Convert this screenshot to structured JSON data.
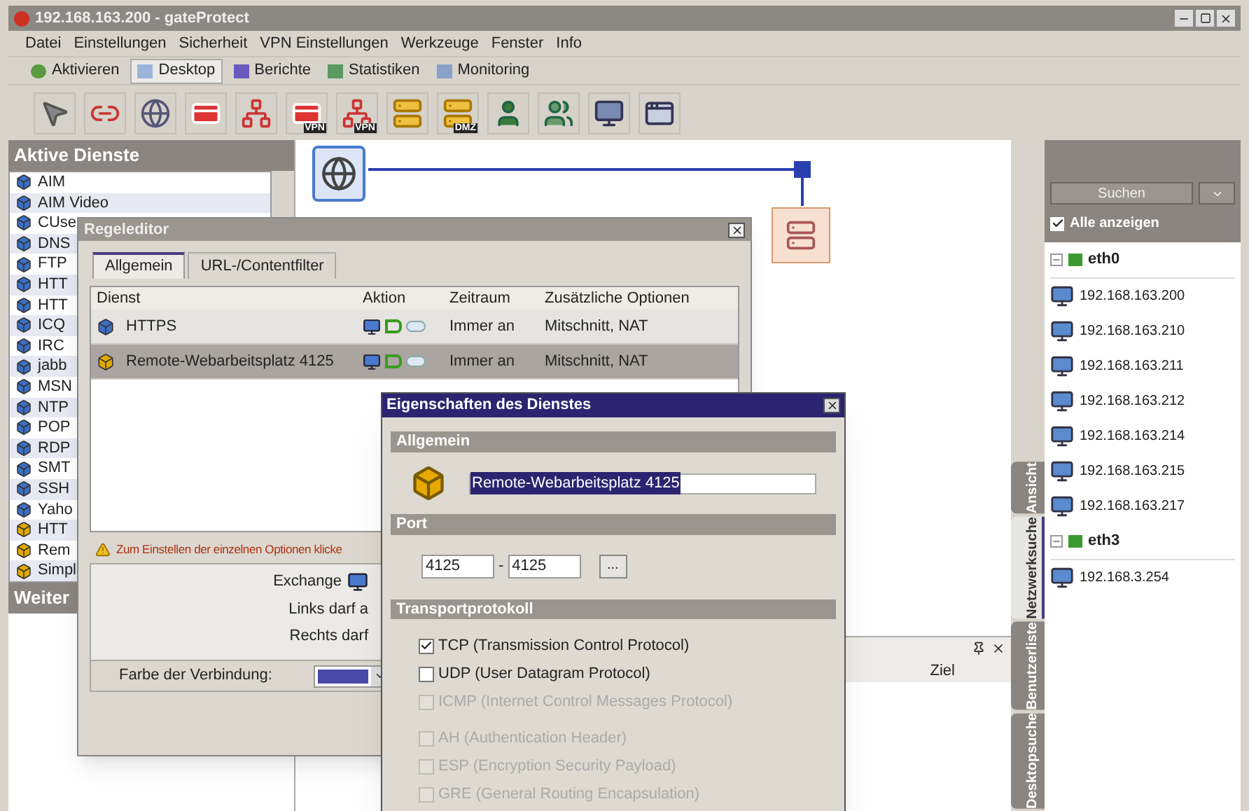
{
  "window": {
    "title": "192.168.163.200 - gateProtect"
  },
  "menu": [
    "Datei",
    "Einstellungen",
    "Sicherheit",
    "VPN Einstellungen",
    "Werkzeuge",
    "Fenster",
    "Info"
  ],
  "nav_tabs": [
    {
      "label": "Aktivieren",
      "selected": false
    },
    {
      "label": "Desktop",
      "selected": true
    },
    {
      "label": "Berichte",
      "selected": false
    },
    {
      "label": "Statistiken",
      "selected": false
    },
    {
      "label": "Monitoring",
      "selected": false
    }
  ],
  "toolbar": [
    {
      "kind": "pointer"
    },
    {
      "kind": "connect"
    },
    {
      "kind": "globe"
    },
    {
      "kind": "card"
    },
    {
      "kind": "link"
    },
    {
      "kind": "card",
      "badge": "VPN"
    },
    {
      "kind": "link",
      "badge": "VPN"
    },
    {
      "kind": "server"
    },
    {
      "kind": "server",
      "badge": "DMZ"
    },
    {
      "kind": "user"
    },
    {
      "kind": "users"
    },
    {
      "kind": "screen"
    },
    {
      "kind": "window"
    }
  ],
  "services_panel": {
    "title": "Aktive Dienste",
    "items": [
      {
        "name": "AIM",
        "kind": "blue"
      },
      {
        "name": "AIM Video",
        "kind": "blue"
      },
      {
        "name": "CUse",
        "kind": "blue"
      },
      {
        "name": "DNS",
        "kind": "blue"
      },
      {
        "name": "FTP",
        "kind": "blue"
      },
      {
        "name": "HTT",
        "kind": "blue"
      },
      {
        "name": "HTT",
        "kind": "blue"
      },
      {
        "name": "ICQ",
        "kind": "blue"
      },
      {
        "name": "IRC",
        "kind": "blue"
      },
      {
        "name": "jabb",
        "kind": "blue"
      },
      {
        "name": "MSN",
        "kind": "blue"
      },
      {
        "name": "NTP",
        "kind": "blue"
      },
      {
        "name": "POP",
        "kind": "blue"
      },
      {
        "name": "RDP",
        "kind": "blue"
      },
      {
        "name": "SMT",
        "kind": "blue"
      },
      {
        "name": "SSH",
        "kind": "blue"
      },
      {
        "name": "Yaho",
        "kind": "blue"
      },
      {
        "name": "HTT",
        "kind": "yellow"
      },
      {
        "name": "Rem",
        "kind": "yellow"
      },
      {
        "name": "Simpl",
        "kind": "yellow"
      }
    ]
  },
  "lower_panel": {
    "title": "Weiter"
  },
  "bottom_panel": {
    "columns": [
      "Ziel"
    ]
  },
  "side_tabs": [
    {
      "label": "Ansicht",
      "selected": false
    },
    {
      "label": "Netzwerksuche",
      "selected": true
    },
    {
      "label": "Benutzerliste",
      "selected": false
    },
    {
      "label": "Desktopsuche",
      "selected": false
    }
  ],
  "right_panel": {
    "search_button": "Suchen",
    "show_all": {
      "label": "Alle anzeigen",
      "checked": true
    },
    "tree": [
      {
        "label": "eth0",
        "expanded": true,
        "children": [
          {
            "label": "192.168.163.200"
          },
          {
            "label": "192.168.163.210"
          },
          {
            "label": "192.168.163.211"
          },
          {
            "label": "192.168.163.212"
          },
          {
            "label": "192.168.163.214"
          },
          {
            "label": "192.168.163.215"
          },
          {
            "label": "192.168.163.217"
          }
        ]
      },
      {
        "label": "eth3",
        "expanded": true,
        "children": [
          {
            "label": "192.168.3.254"
          }
        ]
      }
    ]
  },
  "rule_editor": {
    "title": "Regeleditor",
    "tabs": [
      {
        "label": "Allgemein",
        "selected": true
      },
      {
        "label": "URL-/Contentfilter",
        "selected": false
      }
    ],
    "columns": [
      "Dienst",
      "Aktion",
      "Zeitraum",
      "Zusätzliche Optionen"
    ],
    "rows": [
      {
        "service": "HTTPS",
        "kind": "blue",
        "time": "Immer an",
        "options": "Mitschnitt, NAT",
        "selected": false
      },
      {
        "service": "Remote-Webarbeitsplatz 4125",
        "kind": "yellow",
        "time": "Immer an",
        "options": "Mitschnitt, NAT",
        "selected": true
      }
    ],
    "warning": "Zum Einstellen der einzelnen Optionen klicke",
    "exchange": "Exchange",
    "left_note": "Links darf a",
    "right_note": "Rechts darf",
    "color_label": "Farbe der Verbindung:"
  },
  "properties": {
    "title": "Eigenschaften des Dienstes",
    "general_title": "Allgemein",
    "name": "Remote-Webarbeitsplatz 4125",
    "port_title": "Port",
    "port_from": "4125",
    "port_separator": "-",
    "port_to": "4125",
    "browse_button": "...",
    "protocol_title": "Transportprotokoll",
    "protocols": [
      {
        "label": "TCP (Transmission Control Protocol)",
        "checked": true,
        "disabled": false
      },
      {
        "label": "UDP (User Datagram Protocol)",
        "checked": false,
        "disabled": false
      },
      {
        "label": "ICMP (Internet Control Messages Protocol)",
        "checked": false,
        "disabled": true
      },
      {
        "label": "AH (Authentication Header)",
        "checked": false,
        "disabled": true
      },
      {
        "label": "ESP (Encryption Security Payload)",
        "checked": false,
        "disabled": true
      },
      {
        "label": "GRE (General Routing Encapsulation)",
        "checked": false,
        "disabled": true
      }
    ]
  }
}
